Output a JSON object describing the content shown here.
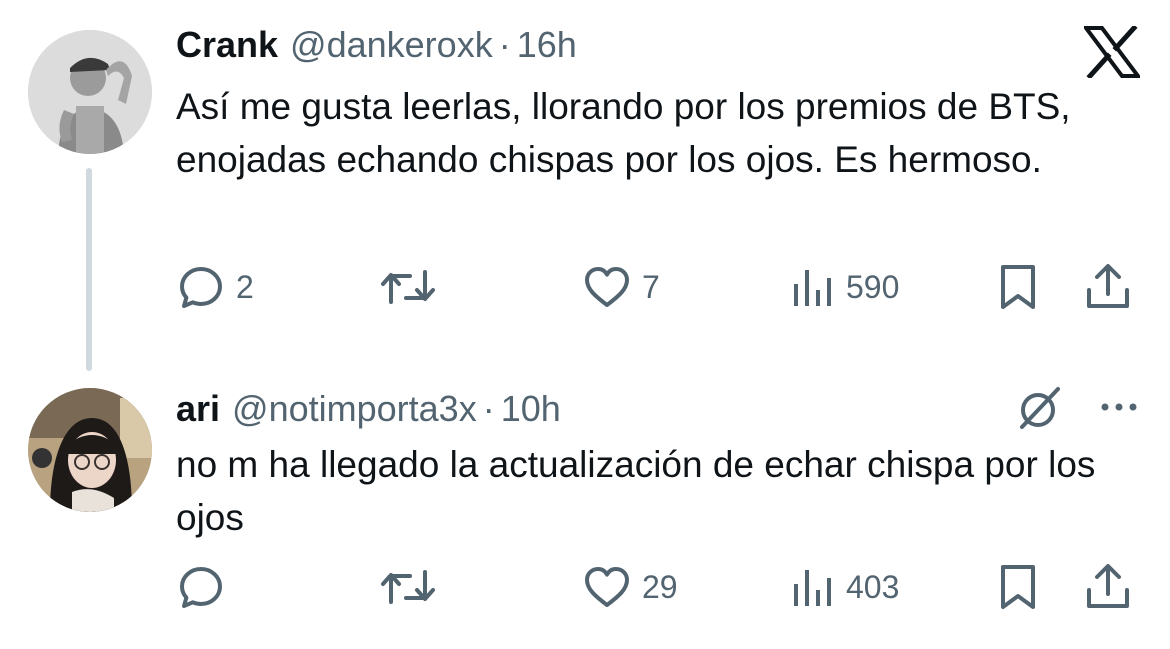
{
  "tweets": [
    {
      "display_name": "Crank",
      "handle": "@dankeroxk",
      "separator": "·",
      "time": "16h",
      "text": "Así me gusta leerlas, llorando por los premios de BTS, enojadas echando chispas por los ojos. Es hermoso.",
      "reply_count": "2",
      "retweet_count": "",
      "like_count": "7",
      "view_count": "590"
    },
    {
      "display_name": "ari",
      "handle": "@notimporta3x",
      "separator": "·",
      "time": "10h",
      "text": "no m ha llegado la actualización de echar chispa por los ojos",
      "reply_count": "",
      "retweet_count": "",
      "like_count": "29",
      "view_count": "403"
    }
  ],
  "icons": {
    "brand": "x-logo-icon",
    "reply": "reply-icon",
    "retweet": "retweet-icon",
    "like": "heart-icon",
    "views": "views-chart-icon",
    "bookmark": "bookmark-icon",
    "share": "share-icon",
    "grok": "grok-icon",
    "more": "more-dots-icon"
  },
  "colors": {
    "text_primary": "#0f1419",
    "text_secondary": "#536471",
    "thread_line": "#cfd9de",
    "background": "#ffffff"
  }
}
